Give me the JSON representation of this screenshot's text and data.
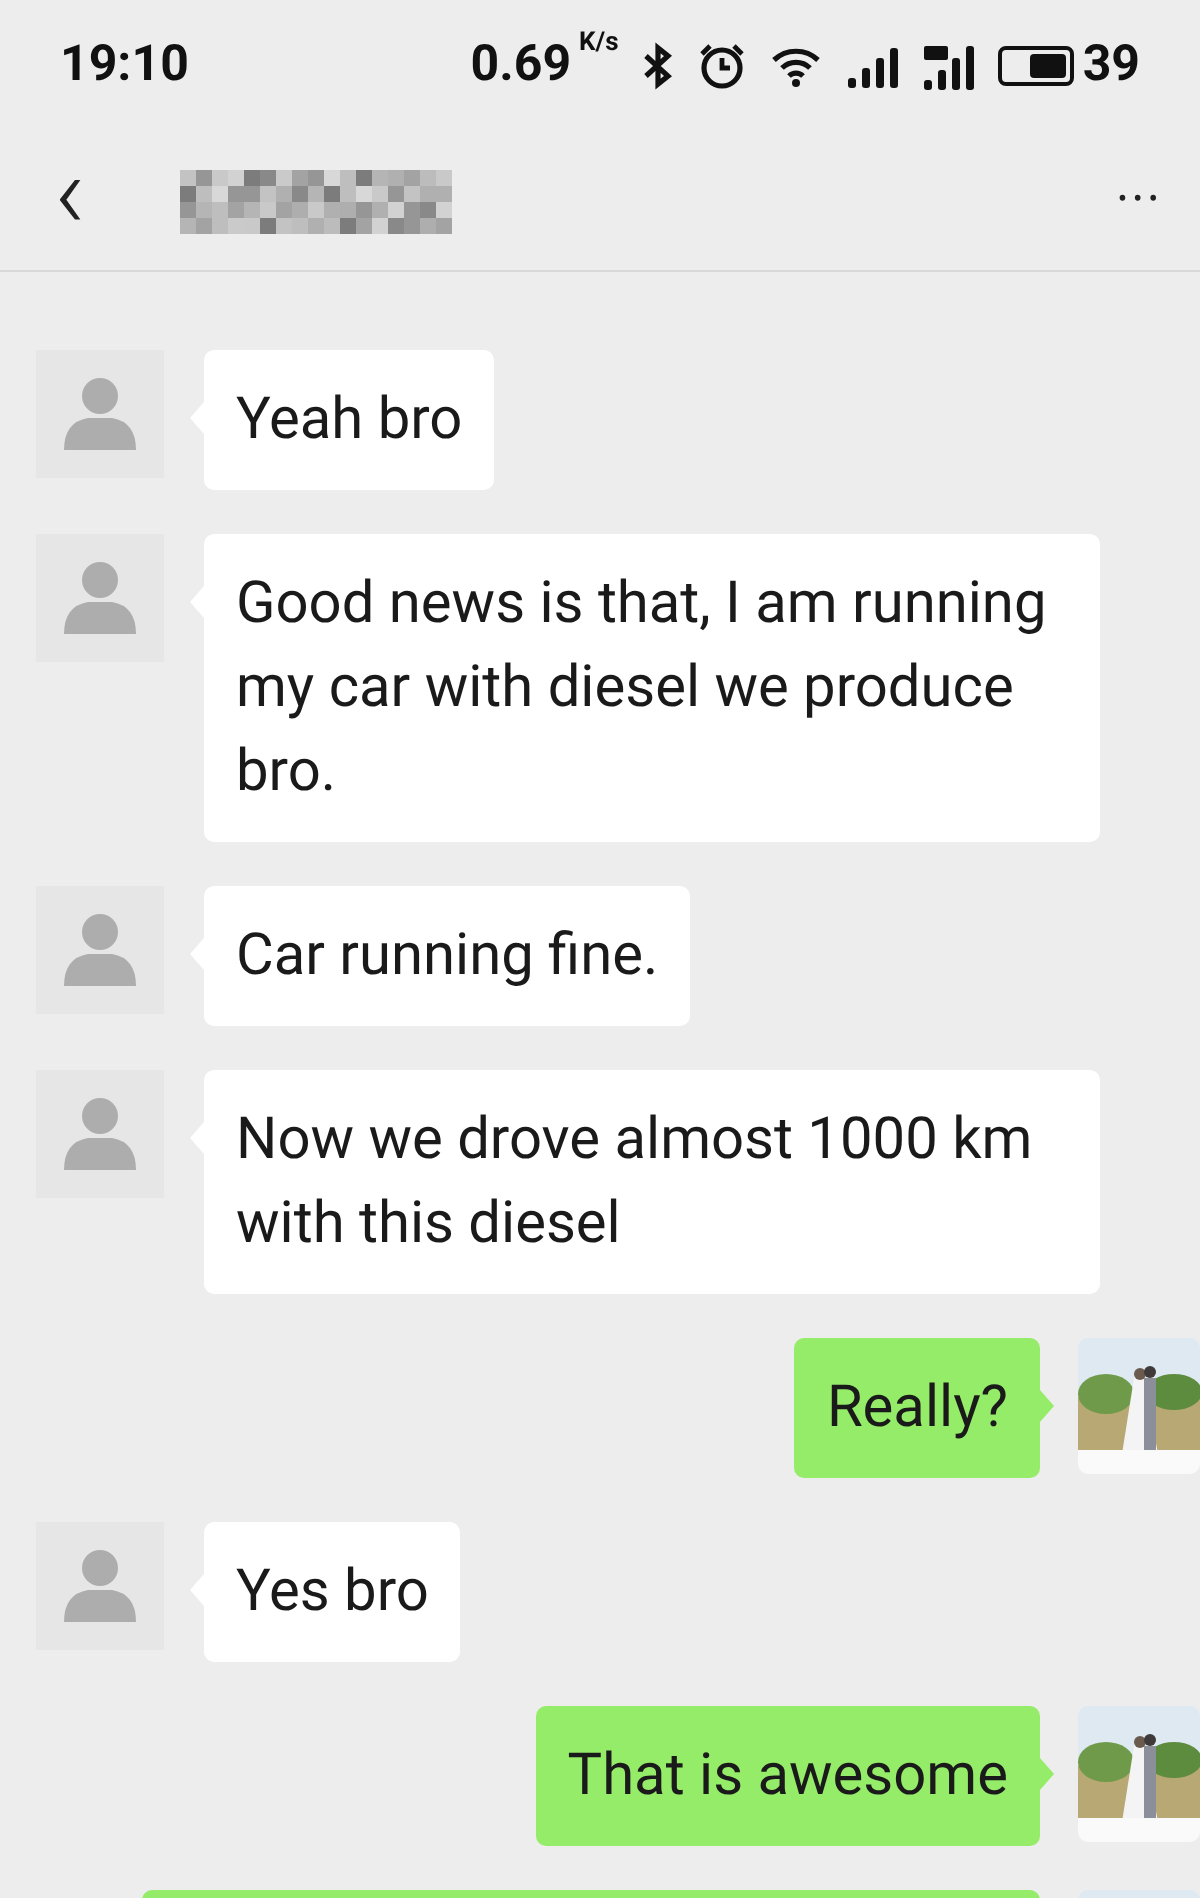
{
  "status_bar": {
    "time": "19:10",
    "speed": "0.69",
    "speed_unit": "K/s",
    "battery": "39"
  },
  "header": {
    "back": "‹",
    "more": "•••"
  },
  "messages": [
    {
      "kind": "incoming",
      "text": "Yeah bro"
    },
    {
      "kind": "incoming",
      "text": "Good news is that, I am running my car with diesel we produce bro."
    },
    {
      "kind": "incoming",
      "text": "Car running fine."
    },
    {
      "kind": "incoming",
      "text": "Now we drove almost 1000 km with this diesel"
    },
    {
      "kind": "outgoing",
      "text": "Really?"
    },
    {
      "kind": "incoming",
      "text": "Yes bro"
    },
    {
      "kind": "outgoing",
      "text": "That is awesome"
    },
    {
      "kind": "outgoing"
    }
  ]
}
